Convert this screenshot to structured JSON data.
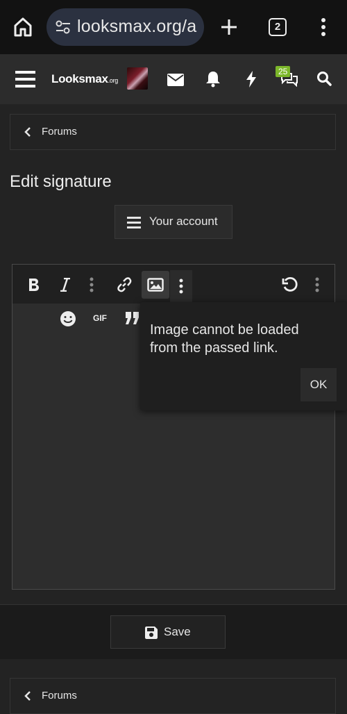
{
  "browser": {
    "url": "looksmax.org/a",
    "tab_count": "2"
  },
  "site": {
    "logo_text": "Looksmax",
    "logo_suffix": ".org",
    "alerts_badge": "25"
  },
  "breadcrumb": {
    "top_label": "Forums",
    "bottom_label": "Forums"
  },
  "page": {
    "title": "Edit signature",
    "account_button": "Your account"
  },
  "editor": {
    "toolbar_icons": [
      "bold-icon",
      "italic-icon",
      "more-options-icon",
      "link-icon",
      "image-icon",
      "more-options-icon",
      "undo-icon",
      "more-options-icon"
    ],
    "second_row_icons": [
      "smiley-icon",
      "gif-icon",
      "quote-icon"
    ],
    "gif_label": "GIF"
  },
  "dialog": {
    "message": "Image cannot be loaded from the passed link.",
    "ok_label": "OK"
  },
  "footer": {
    "save_label": "Save"
  },
  "colors": {
    "badge": "#7cb72a",
    "background": "#232323",
    "header": "#2c2c2c"
  }
}
